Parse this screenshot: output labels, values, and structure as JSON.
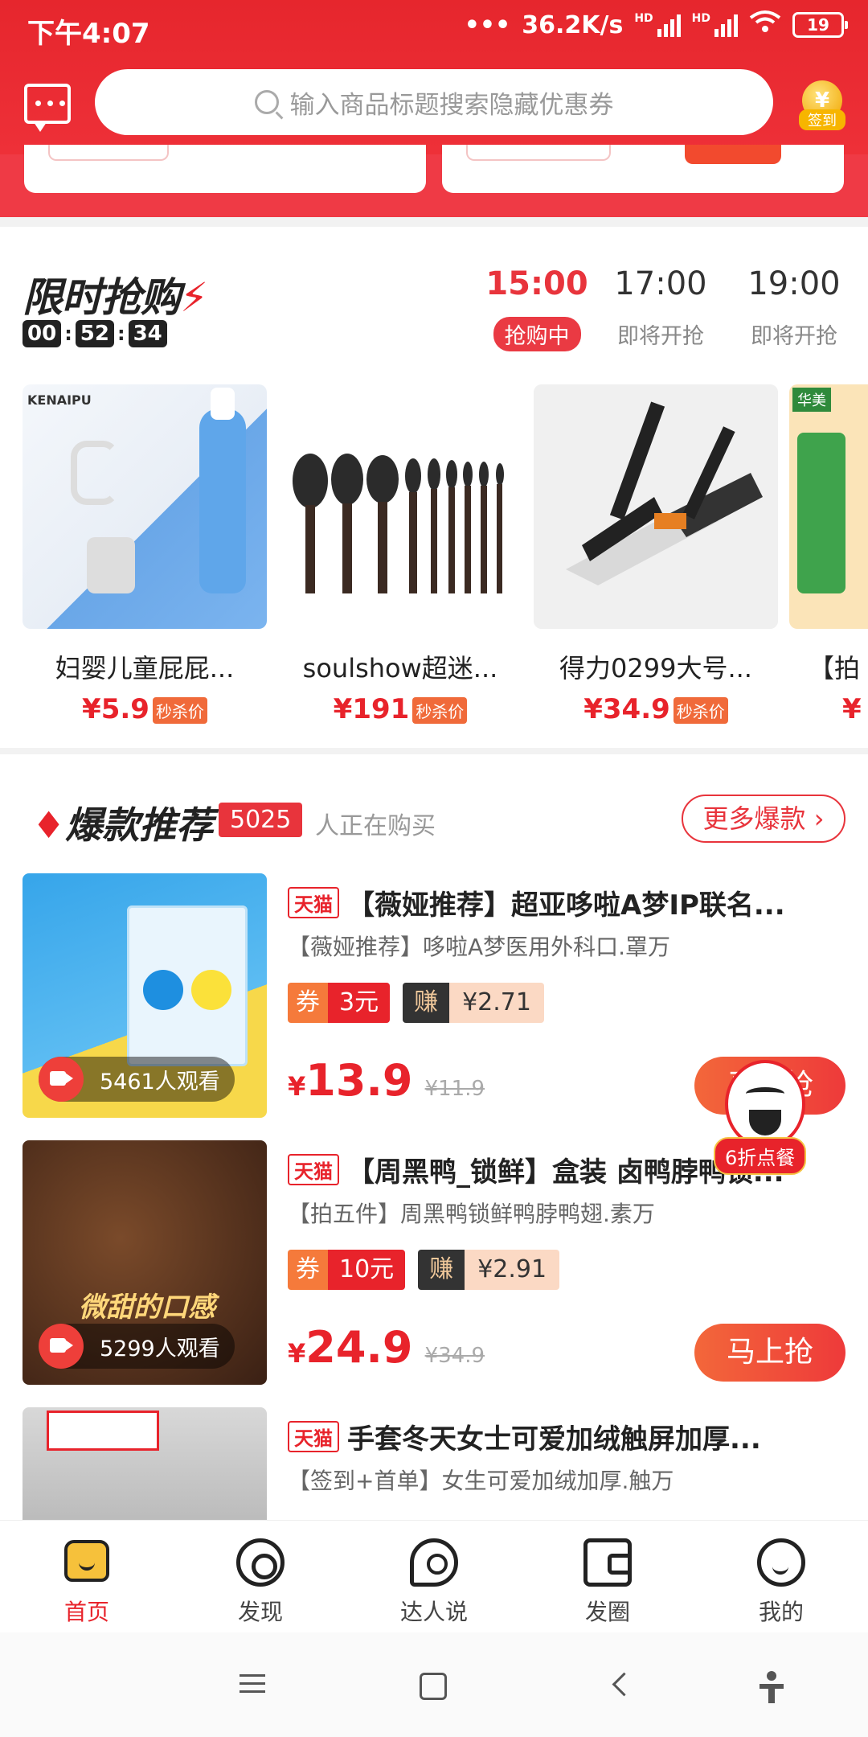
{
  "status": {
    "time": "下午4:07",
    "speed": "36.2K/s",
    "hd1": "HD",
    "hd2": "HD",
    "battery": "19"
  },
  "header": {
    "search_placeholder": "输入商品标题搜索隐藏优惠券",
    "checkin_label": "签到"
  },
  "flash": {
    "title": "限时抢购",
    "countdown": {
      "h": "00",
      "m": "52",
      "s": "34"
    },
    "slots": [
      {
        "time": "15:00",
        "status": "抢购中"
      },
      {
        "time": "17:00",
        "status": "即将开抢"
      },
      {
        "time": "19:00",
        "status": "即将开抢"
      }
    ],
    "items": [
      {
        "name": "妇婴儿童屁屁...",
        "price": "¥5.9",
        "tag": "秒杀价",
        "brand": "KENAIPU"
      },
      {
        "name": "soulshow超迷...",
        "price": "¥191",
        "tag": "秒杀价"
      },
      {
        "name": "得力0299大号...",
        "price": "¥34.9",
        "tag": "秒杀价"
      },
      {
        "name": "【拍",
        "price": "¥",
        "tag": "",
        "brand": "华美"
      }
    ]
  },
  "hot": {
    "title": "爆款推荐",
    "count": "5025",
    "count_suffix": "人正在购买",
    "more": "更多爆款",
    "platform": "天猫",
    "coupon_label": "券",
    "earn_label": "赚",
    "buy_label": "马上抢",
    "products": [
      {
        "title": "【薇娅推荐】超亚哆啦A梦IP联名...",
        "subtitle": "【薇娅推荐】哆啦A梦医用外科口.罩万",
        "coupon": "3元",
        "earn": "¥2.71",
        "price_symbol": "¥",
        "price": "13.9",
        "old_price": "¥11.9",
        "viewers": "5461人观看"
      },
      {
        "title": "【周黑鸭_锁鲜】盒装 卤鸭脖鸭锁...",
        "subtitle": "【拍五件】周黑鸭锁鲜鸭脖鸭翅.素万",
        "coupon": "10元",
        "earn": "¥2.91",
        "price_symbol": "¥",
        "price": "24.9",
        "old_price": "¥34.9",
        "viewers": "5299人观看",
        "img_text": "微甜的口感"
      },
      {
        "title": "手套冬天女士可爱加绒触屏加厚...",
        "subtitle": "【签到+首单】女生可爱加绒加厚.触万"
      }
    ]
  },
  "kfc_badge": "6折点餐",
  "tabs": [
    {
      "label": "首页",
      "icon": "home-icon",
      "active": true
    },
    {
      "label": "发现",
      "icon": "discover-icon"
    },
    {
      "label": "达人说",
      "icon": "talk-icon"
    },
    {
      "label": "发圈",
      "icon": "wallet-icon"
    },
    {
      "label": "我的",
      "icon": "profile-icon"
    }
  ],
  "colors": {
    "brand_red": "#e8232b",
    "header_red": "#e6262d",
    "coupon_orange": "#f57a3b",
    "gold": "#f6c13b"
  }
}
